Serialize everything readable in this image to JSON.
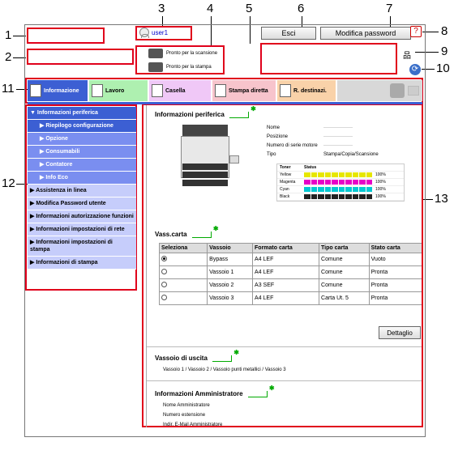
{
  "callouts": [
    "1",
    "2",
    "3",
    "4",
    "5",
    "6",
    "7",
    "8",
    "9",
    "10",
    "11",
    "12",
    "13"
  ],
  "header": {
    "user_name": "user1",
    "scan_status": "Pronto per la scansione",
    "print_status": "Pronto per la stampa",
    "logout_label": "Esci",
    "change_password_label": "Modifica password",
    "help_icon": "?"
  },
  "tabs": [
    {
      "label": "Informazione",
      "icon": "info-icon"
    },
    {
      "label": "Lavoro",
      "icon": "job-icon"
    },
    {
      "label": "Casella",
      "icon": "box-icon"
    },
    {
      "label": "Stampa diretta",
      "icon": "direct-print-icon"
    },
    {
      "label": "R. destinazi.",
      "icon": "address-book-icon"
    }
  ],
  "sidebar": {
    "items": [
      {
        "label": "▼ Informazioni periferica"
      },
      {
        "label": "▶ Riepilogo configurazione"
      },
      {
        "label": "▶ Opzione"
      },
      {
        "label": "▶ Consumabili"
      },
      {
        "label": "▶ Contatore"
      },
      {
        "label": "▶ Info Eco"
      },
      {
        "label": "▶ Assistenza in linea"
      },
      {
        "label": "▶ Modifica Password utente"
      },
      {
        "label": "▶ Informazioni autorizzazione funzioni"
      },
      {
        "label": "▶ Informazioni impostazioni di rete"
      },
      {
        "label": "▶ Informazioni impostazioni di stampa"
      },
      {
        "label": "▶ Informazioni di stampa"
      }
    ]
  },
  "device_info": {
    "title": "Informazioni periferica",
    "rows": [
      {
        "key": "Nome",
        "value": "——————"
      },
      {
        "key": "Posizione",
        "value": "——————"
      },
      {
        "key": "Numero di serie motore",
        "value": "——————"
      },
      {
        "key": "Tipo",
        "value": "Stampa/Copia/Scansione"
      }
    ]
  },
  "toner": {
    "header_toner": "Toner",
    "header_status": "Status",
    "rows": [
      {
        "name": "Yellow",
        "color": "#e6e600",
        "pct": "100%"
      },
      {
        "name": "Magenta",
        "color": "#e600c8",
        "pct": "100%"
      },
      {
        "name": "Cyan",
        "color": "#00c8d2",
        "pct": "100%"
      },
      {
        "name": "Black",
        "color": "#222222",
        "pct": "100%"
      }
    ]
  },
  "paper_trays": {
    "title": "Vass.carta",
    "headers": [
      "Seleziona",
      "Vassoio",
      "Formato carta",
      "Tipo carta",
      "Stato carta"
    ],
    "rows": [
      {
        "tray": "Bypass",
        "format": "A4 LEF",
        "type": "Comune",
        "status": "Vuoto",
        "selected": true
      },
      {
        "tray": "Vassoio 1",
        "format": "A4 LEF",
        "type": "Comune",
        "status": "Pronta",
        "selected": false
      },
      {
        "tray": "Vassoio 2",
        "format": "A3 SEF",
        "type": "Comune",
        "status": "Pronta",
        "selected": false
      },
      {
        "tray": "Vassoio 3",
        "format": "A4 LEF",
        "type": "Carta Ut. 5",
        "status": "Pronta",
        "selected": false
      }
    ],
    "detail_label": "Dettaglio"
  },
  "output_tray": {
    "title": "Vassoio di uscita",
    "value": "Vassoio 1 / Vassoio 2 / Vassoio punti metallici / Vassoio 3"
  },
  "admin_info": {
    "title": "Informazioni Amministratore",
    "rows": [
      "Nome Amministratore",
      "Numero estensione",
      "Indir. E-Mail Amministratore"
    ]
  },
  "colors": {
    "tab_active": "#3c5fd3",
    "callout_box": "#e0001b"
  }
}
